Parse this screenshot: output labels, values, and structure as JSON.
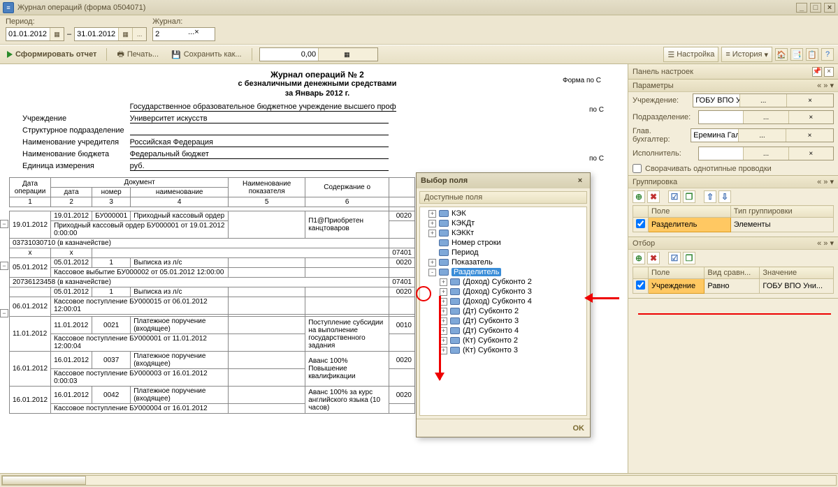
{
  "window_title": "Журнал операций (форма 0504071)",
  "period": {
    "label": "Период:",
    "from": "01.01.2012",
    "to": "31.01.2012"
  },
  "journal": {
    "label": "Журнал:",
    "value": "2"
  },
  "commands": {
    "form_report": "Сформировать отчет",
    "print": "Печать...",
    "save_as": "Сохранить как...",
    "sum_value": "0,00",
    "config": "Настройка",
    "history": "История"
  },
  "report": {
    "title": "Журнал операций № 2",
    "subtitle": "с безналичными денежными средствами",
    "period_line": "за Январь 2012 г.",
    "form_by": "Форма по С",
    "by_c1": "по С",
    "by_c2": "по С",
    "meta": {
      "inst_full": "Государственное образовательное бюджетное учреждение высшего проф",
      "uchrezhdenie_lbl": "Учреждение",
      "uchrezhdenie_val": "Университет искусств",
      "struct_lbl": "Структурное подразделение",
      "founder_lbl": "Наименование учредителя",
      "founder_val": "Российская Федерация",
      "budget_lbl": "Наименование бюджета",
      "budget_val": "Федеральный бюджет",
      "unit_lbl": "Единица измерения",
      "unit_val": "руб."
    },
    "headers": {
      "date_op": "Дата операции",
      "document": "Документ",
      "date": "дата",
      "number": "номер",
      "name": "наименование",
      "pokaz": "Наименование показателя",
      "content": "Содержание о",
      "c1": "1",
      "c2": "2",
      "c3": "3",
      "c4": "4",
      "c5": "5",
      "c6": "6"
    },
    "rows": [
      {
        "date_op": "19.01.2012",
        "date": "19.01.2012",
        "num": "БУ000001",
        "name": "Приходный кассовый ордер",
        "content": "П1@Приобретен канцтоваров",
        "foot": "Приходный кассовый ордер БУ000001 от 19.01.2012 0:00:00",
        "code": "0020"
      },
      {
        "grouphdr": "03731030710 (в казначействе)",
        "x": "x"
      },
      {
        "date_op": "05.01.2012",
        "date": "05.01.2012",
        "num": "1",
        "name": "Выписка из л/с",
        "foot": "Кассовое выбытие БУ000002 от 05.01.2012 12:00:00",
        "code": "07401",
        "code2": "0020"
      },
      {
        "grouphdr": "20736123458 (в казначействе)",
        "code": "07401"
      },
      {
        "sub": "05.01.2012",
        "subnum": "1",
        "subname": "Выписка из л/с",
        "subcode": "0020"
      },
      {
        "date_op": "06.01.2012",
        "foot": "Кассовое поступление БУ000015 от 06.01.2012 12:00:01"
      },
      {
        "date_op": "11.01.2012",
        "date": "11.01.2012",
        "num": "0021",
        "name": "Платежное поручение (входящее)",
        "content": "Поступление субсидии на выполнение государственного задания",
        "foot": "Кассовое поступление БУ000001 от 11.01.2012 12:00:04",
        "code": "0010"
      },
      {
        "date_op": "16.01.2012",
        "date": "16.01.2012",
        "num": "0037",
        "name": "Платежное поручение (входящее)",
        "content": "Аванс 100% Повышение квалификации",
        "foot": "Кассовое поступление БУ000003 от 16.01.2012 0:00:03",
        "code": "0020"
      },
      {
        "date_op": "16.01.2012",
        "date": "16.01.2012",
        "num": "0042",
        "name": "Платежное поручение (входящее)",
        "content": "Аванс 100% за курс английского языка (10 часов)",
        "foot": "Кассовое поступление БУ000004 от 16.01.2012",
        "code": "0020"
      }
    ]
  },
  "dialog": {
    "title": "Выбор поля",
    "available": "Доступные поля",
    "ok": "OK",
    "items": [
      {
        "lvl": 1,
        "exp": "+",
        "label": "КЭК"
      },
      {
        "lvl": 1,
        "exp": "+",
        "label": "КЭКДт"
      },
      {
        "lvl": 1,
        "exp": "+",
        "label": "КЭККт"
      },
      {
        "lvl": 1,
        "exp": "",
        "label": "Номер строки"
      },
      {
        "lvl": 1,
        "exp": "",
        "label": "Период"
      },
      {
        "lvl": 1,
        "exp": "+",
        "label": "Показатель"
      },
      {
        "lvl": 1,
        "exp": "-",
        "label": "Разделитель",
        "sel": true
      },
      {
        "lvl": 2,
        "exp": "+",
        "label": "(Доход) Субконто 2"
      },
      {
        "lvl": 2,
        "exp": "+",
        "label": "(Доход) Субконто 3"
      },
      {
        "lvl": 2,
        "exp": "+",
        "label": "(Доход) Субконто 4"
      },
      {
        "lvl": 2,
        "exp": "+",
        "label": "(Дт) Субконто 2"
      },
      {
        "lvl": 2,
        "exp": "+",
        "label": "(Дт) Субконто 3"
      },
      {
        "lvl": 2,
        "exp": "+",
        "label": "(Дт) Субконто 4"
      },
      {
        "lvl": 2,
        "exp": "+",
        "label": "(Кт) Субконто 2"
      },
      {
        "lvl": 2,
        "exp": "+",
        "label": "(Кт) Субконто 3"
      }
    ]
  },
  "settings": {
    "panel_title": "Панель настроек",
    "params": {
      "title": "Параметры",
      "uchrezhdenie_lbl": "Учреждение:",
      "uchrezhdenie_val": "ГОБУ ВПО Университет искусс",
      "podrazd_lbl": "Подразделение:",
      "glavbuh_lbl": "Глав. бухгалтер:",
      "glavbuh_val": "Еремина Галина Александровн",
      "ispolnitel_lbl": "Исполнитель:",
      "collapse": "Сворачивать однотипные проводки"
    },
    "grouping": {
      "title": "Группировка",
      "col_field": "Поле",
      "col_type": "Тип группировки",
      "row_field": "Разделитель",
      "row_type": "Элементы"
    },
    "filter": {
      "title": "Отбор",
      "col_field": "Поле",
      "col_cmp": "Вид сравн...",
      "col_val": "Значение",
      "row_field": "Учреждение",
      "row_cmp": "Равно",
      "row_val": "ГОБУ ВПО Уни..."
    }
  }
}
